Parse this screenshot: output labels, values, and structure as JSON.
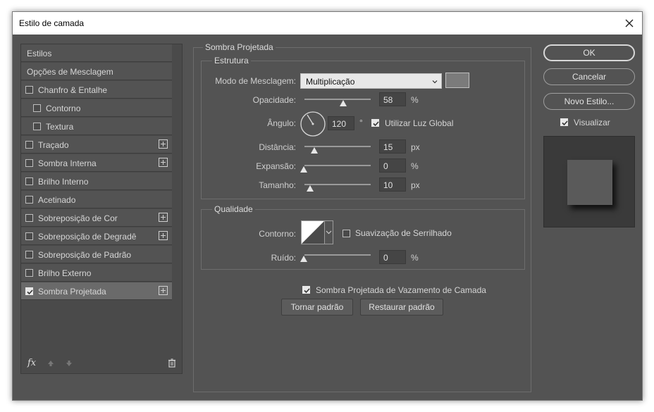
{
  "window": {
    "title": "Estilo de camada"
  },
  "styles_panel": {
    "items": [
      {
        "label": "Estilos",
        "checkbox": false,
        "plus": false
      },
      {
        "label": "Opções de Mesclagem",
        "checkbox": false,
        "plus": false
      },
      {
        "label": "Chanfro & Entalhe",
        "checkbox": true,
        "checked": false,
        "plus": false
      },
      {
        "label": "Contorno",
        "checkbox": true,
        "checked": false,
        "plus": false,
        "indent": true
      },
      {
        "label": "Textura",
        "checkbox": true,
        "checked": false,
        "plus": false,
        "indent": true
      },
      {
        "label": "Traçado",
        "checkbox": true,
        "checked": false,
        "plus": true
      },
      {
        "label": "Sombra Interna",
        "checkbox": true,
        "checked": false,
        "plus": true
      },
      {
        "label": "Brilho Interno",
        "checkbox": true,
        "checked": false,
        "plus": false
      },
      {
        "label": "Acetinado",
        "checkbox": true,
        "checked": false,
        "plus": false
      },
      {
        "label": "Sobreposição de Cor",
        "checkbox": true,
        "checked": false,
        "plus": true
      },
      {
        "label": "Sobreposição de Degradê",
        "checkbox": true,
        "checked": false,
        "plus": true
      },
      {
        "label": "Sobreposição de Padrão",
        "checkbox": true,
        "checked": false,
        "plus": false
      },
      {
        "label": "Brilho Externo",
        "checkbox": true,
        "checked": false,
        "plus": false
      },
      {
        "label": "Sombra Projetada",
        "checkbox": true,
        "checked": true,
        "plus": true,
        "active": true
      }
    ],
    "footer": {
      "fx": "fx"
    }
  },
  "drop_shadow": {
    "section_title": "Sombra Projetada",
    "structure": {
      "title": "Estrutura",
      "blend_mode_label": "Modo de Mesclagem:",
      "blend_mode_value": "Multiplicação",
      "shadow_color": "#7b7b7b",
      "opacity_label": "Opacidade:",
      "opacity_value": "58",
      "opacity_unit": "%",
      "opacity_fraction": 0.58,
      "angle_label": "Ângulo:",
      "angle_value": "120",
      "angle_unit": "°",
      "global_light_label": "Utilizar Luz Global",
      "global_light_checked": true,
      "distance_label": "Distância:",
      "distance_value": "15",
      "distance_unit": "px",
      "spread_label": "Expansão:",
      "spread_value": "0",
      "spread_unit": "%",
      "size_label": "Tamanho:",
      "size_value": "10",
      "size_unit": "px"
    },
    "quality": {
      "title": "Qualidade",
      "contour_label": "Contorno:",
      "antialias_label": "Suavização de Serrilhado",
      "antialias_checked": false,
      "noise_label": "Ruído:",
      "noise_value": "0",
      "noise_unit": "%"
    },
    "knockout_label": "Sombra Projetada de Vazamento de Camada",
    "knockout_checked": true,
    "make_default_label": "Tornar padrão",
    "reset_default_label": "Restaurar padrão"
  },
  "actions": {
    "ok_label": "OK",
    "cancel_label": "Cancelar",
    "new_style_label": "Novo Estilo...",
    "preview_label": "Visualizar",
    "preview_checked": true
  }
}
